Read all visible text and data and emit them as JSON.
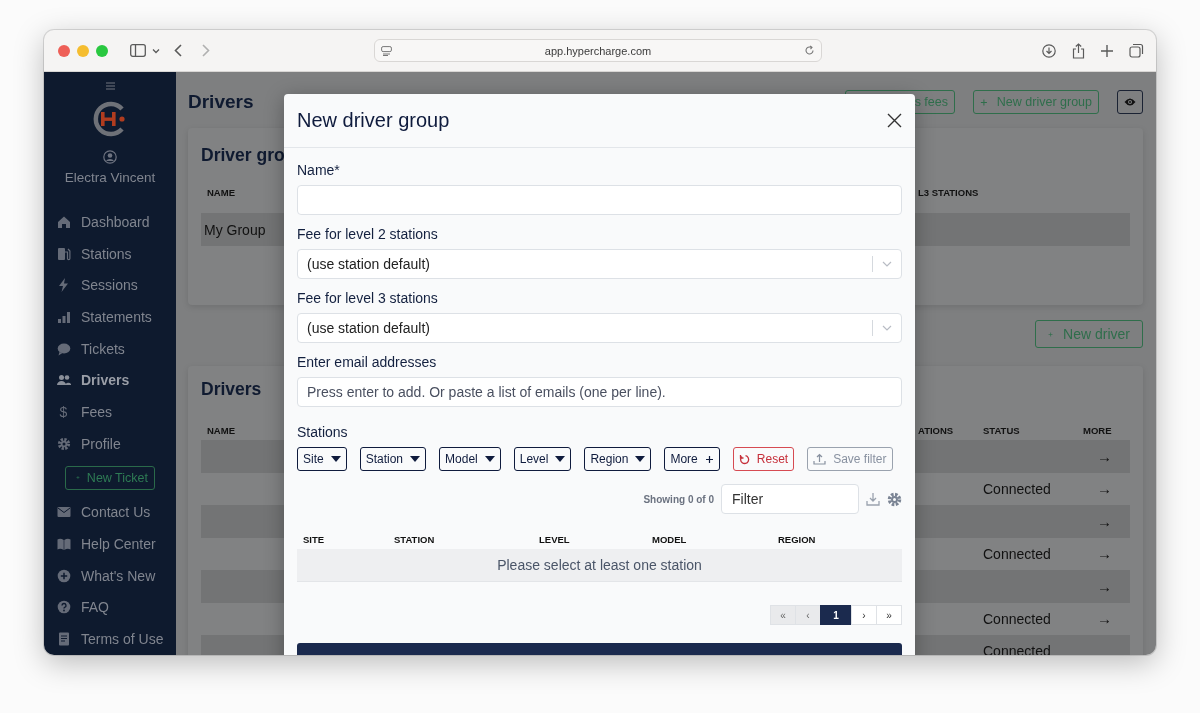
{
  "browser": {
    "url": "app.hypercharge.com"
  },
  "sidebar": {
    "user": "Electra Vincent",
    "items": [
      {
        "label": "Dashboard",
        "selected": false
      },
      {
        "label": "Stations",
        "selected": false
      },
      {
        "label": "Sessions",
        "selected": false
      },
      {
        "label": "Statements",
        "selected": false
      },
      {
        "label": "Tickets",
        "selected": false
      },
      {
        "label": "Drivers",
        "selected": true
      },
      {
        "label": "Fees",
        "selected": false,
        "icon": "$"
      },
      {
        "label": "Profile",
        "selected": false
      }
    ],
    "new_ticket": "New Ticket",
    "help_items": [
      {
        "label": "Contact Us"
      },
      {
        "label": "Help Center"
      },
      {
        "label": "What's New"
      },
      {
        "label": "FAQ"
      },
      {
        "label": "Terms of Use"
      }
    ]
  },
  "page": {
    "title": "Drivers",
    "actions": [
      {
        "label": "s fees",
        "kind": "plain"
      },
      {
        "label": "New driver group",
        "kind": "add"
      }
    ],
    "groups_card": {
      "title": "Driver gro",
      "columns": [
        "NAME",
        "L3 STATIONS"
      ],
      "rows": [
        {
          "name": "My Group"
        }
      ]
    },
    "new_driver": "New driver",
    "drivers_card": {
      "title": "Drivers",
      "columns": [
        "NAME",
        "ATIONS",
        "STATUS",
        "MORE"
      ],
      "rows": [
        {
          "more": "→"
        },
        {
          "status": "Connected",
          "more": "→"
        },
        {
          "more": "→"
        },
        {
          "status": "Connected",
          "more": "→"
        },
        {
          "more": "→"
        },
        {
          "status": "Connected",
          "more": "→"
        },
        {
          "status": "Connected"
        }
      ]
    }
  },
  "modal": {
    "title": "New driver group",
    "fields": [
      {
        "label": "Name*",
        "kind": "text"
      },
      {
        "label": "Fee for level 2 stations",
        "kind": "select",
        "value": "(use station default)"
      },
      {
        "label": "Fee for level 3 stations",
        "kind": "select",
        "value": "(use station default)"
      },
      {
        "label": "Enter email addresses",
        "kind": "text",
        "placeholder": "Press enter to add. Or paste a list of emails (one per line)."
      }
    ],
    "stations": {
      "label": "Stations",
      "filters": [
        {
          "label": "Site",
          "kind": "dropdown"
        },
        {
          "label": "Station",
          "kind": "dropdown"
        },
        {
          "label": "Model",
          "kind": "dropdown"
        },
        {
          "label": "Level",
          "kind": "dropdown"
        },
        {
          "label": "Region",
          "kind": "dropdown"
        },
        {
          "label": "More",
          "kind": "add"
        }
      ],
      "reset": "Reset",
      "save_filter": "Save filter",
      "showing": "Showing 0 of 0",
      "filter_placeholder": "Filter",
      "columns": [
        "SITE",
        "STATION",
        "LEVEL",
        "MODEL",
        "REGION"
      ],
      "empty": "Please select at least one station",
      "pagination": [
        {
          "label": "«",
          "selected": false,
          "disabled": true
        },
        {
          "label": "‹",
          "selected": false,
          "disabled": true
        },
        {
          "label": "1",
          "selected": true,
          "disabled": false
        },
        {
          "label": "›",
          "selected": false,
          "disabled": false
        },
        {
          "label": "»",
          "selected": false,
          "disabled": false
        }
      ]
    }
  }
}
